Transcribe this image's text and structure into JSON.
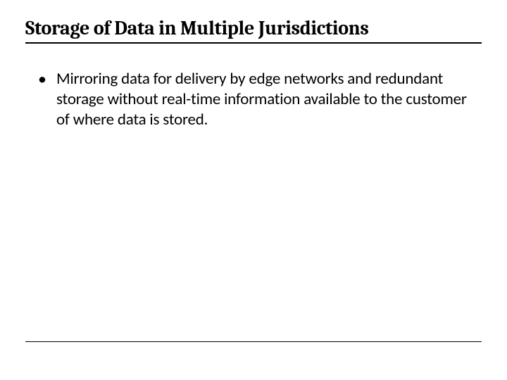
{
  "slide": {
    "title": "Storage of Data in Multiple Jurisdictions",
    "bullets": [
      "Mirroring data for delivery by edge networks and redundant storage without real-time information available to the customer of where data is stored."
    ]
  }
}
